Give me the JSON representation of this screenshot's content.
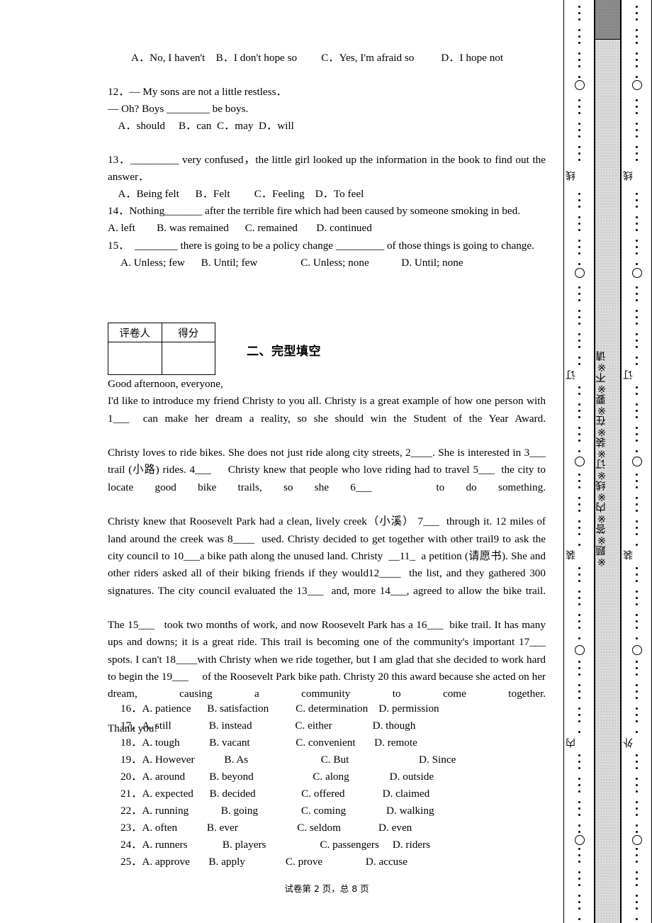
{
  "document": {
    "type": "exam-paper",
    "language": "zh-en",
    "footer": "试卷第 2 页，总 8 页"
  },
  "questions": {
    "q11_options": "A．No, I haven't    B．I don't hope so         C．Yes, I'm afraid so          D．I hope not",
    "q12": {
      "line1": "12．— My sons are not a little restless．",
      "line2": "— Oh? Boys ________ be boys.",
      "options": "    A．should     B．can  C．may  D．will"
    },
    "q13": {
      "stem": "13．_________ very confused，the little girl looked up the information in the book to find out the answer．",
      "options": "    A．Being felt      B．Felt         C．Feeling    D．To feel"
    },
    "q14": {
      "stem": "14．Nothing_______ after the terrible fire which had been caused by someone smoking in bed.",
      "options": "A. left        B. was remained      C. remained       D. continued"
    },
    "q15": {
      "stem": "15．  ________ there is going to be a policy change _________ of those things is going to change.",
      "options": "     A. Unless; few      B. Until; few                C. Unless; none            D. Until; none"
    }
  },
  "score_table": {
    "header_grader": "评卷人",
    "header_score": "得分",
    "grader_value": "",
    "score_value": ""
  },
  "section": {
    "title": "二、完型填空"
  },
  "passage": {
    "greeting": "Good afternoon, everyone,",
    "p1": "I'd like to introduce my friend Christy to you all. Christy is a great example of how one person with 1___  can make her dream a reality, so she should win the Student of the Year Award.",
    "p2": "Christy loves to ride bikes. She does not just ride along city streets, 2____. She is interested in 3___  trail (小路) rides. 4___     Christy knew that people who love riding had to travel 5___  the city to locate good bike trails, so she 6___   to do something.",
    "p3": "Christy knew that Roosevelt Park had a clean, lively creek（小溪） 7___  through it. 12 miles of land around the creek was 8____  used. Christy decided to get together with other trail9 to ask the city council to 10___a bike path along the unused land. Christy  __11_  a petition (请愿书). She and other riders asked all of their biking friends if they would12____  the list, and they gathered 300 signatures. The city council evaluated the 13___  and, more 14___, agreed to allow the bike trail.",
    "p4": "The 15___   took two months of work, and now Roosevelt Park has a 16___  bike trail. It has many ups and downs; it is a great ride. This trail is becoming one of the community's important 17___  spots. I can't 18____with Christy when we ride together, but I am glad that she decided to work hard to begin the 19___     of the Roosevelt Park bike path. Christy 20 this award because she acted on her dream, causing a community to come together.",
    "closing": "Thank you!"
  },
  "choices": [
    "16．A. patience      B. satisfaction          C. determination    D. permission",
    "17．A. still              B. instead                C. either               D. though",
    "18．A. tough           B. vacant                 C. convenient       D. remote",
    "19．A. However           B. As                           C. But                          D. Since",
    "20．A. around         B. beyond                      C. along               D. outside",
    "21．A. expected      B. decided                 C. offered              D. claimed",
    "22．A. running            B. going                C. coming               D. walking",
    "23．A. often           B. ever                      C. seldom              D. even",
    "24．A. runners             B. players                    C. passengers     D. riders",
    "25．A. approve       B. apply               C. prove                D. accuse"
  ],
  "margin": {
    "seal_text": "※题※答※内※线※订※装※在※要※不※请",
    "left_column_marks": [
      "线",
      "订",
      "装",
      "内"
    ],
    "right_column_marks": [
      "线",
      "订",
      "装",
      "外"
    ]
  }
}
